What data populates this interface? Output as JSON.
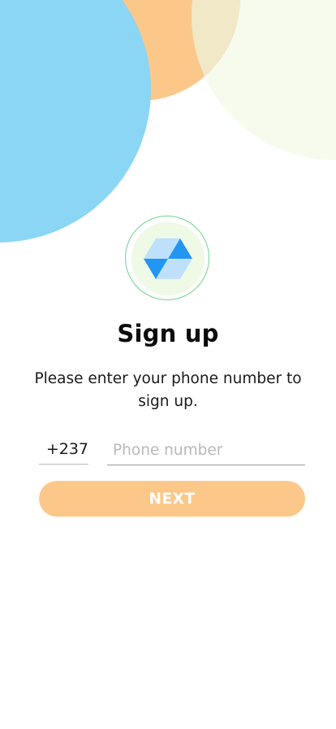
{
  "signup": {
    "title": "Sign up",
    "subtitle": "Please enter your phone number to sign up.",
    "country_code": "+237",
    "phone_placeholder": "Phone number",
    "phone_value": "",
    "next_label": "NEXT"
  },
  "colors": {
    "accent_orange": "#fcc88a",
    "bubble_blue": "#8bd6f4",
    "bubble_cream": "#f6fbee",
    "logo_ring": "#6fd48e",
    "logo_disc": "#eef9e6",
    "logo_dark_blue": "#2196f3",
    "logo_light_blue": "#bfe0fb"
  },
  "icons": {
    "logo": "blue-cube-logo-icon"
  }
}
